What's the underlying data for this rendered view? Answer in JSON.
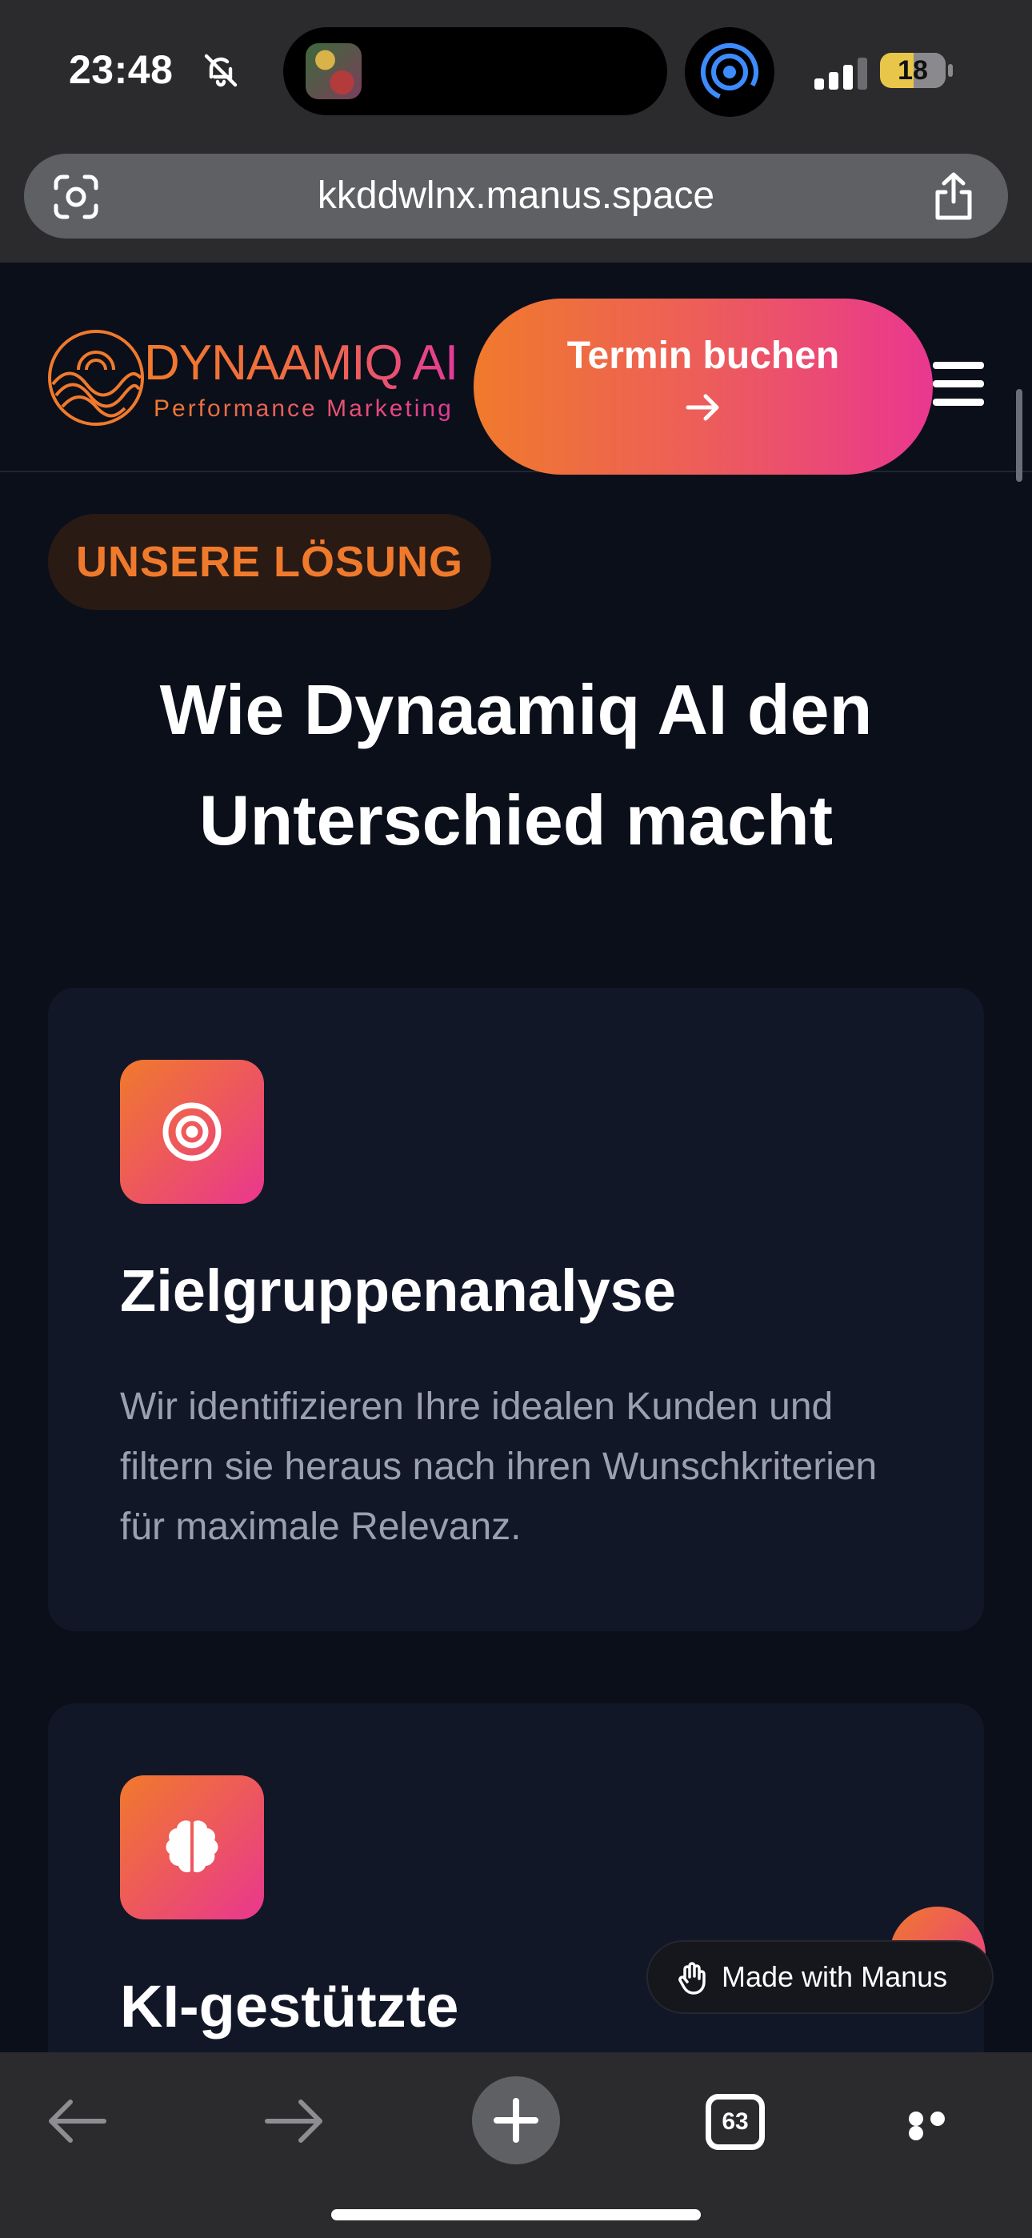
{
  "status_bar": {
    "time": "23:48",
    "battery": "18"
  },
  "browser": {
    "url": "kkddwlnx.manus.space",
    "tab_count": "63"
  },
  "header": {
    "logo_name": "DYNAAMIQ AI",
    "logo_tagline": "Performance Marketing",
    "cta_label": "Termin buchen"
  },
  "main": {
    "badge": "UNSERE LÖSUNG",
    "headline": "Wie Dynaamiq AI den Unterschied macht",
    "cards": [
      {
        "icon": "target-icon",
        "title": "Zielgruppenanalyse",
        "text": "Wir identifizieren Ihre idealen Kunden und filtern sie heraus nach ihren Wunschkriterien für maximale Relevanz."
      },
      {
        "icon": "brain-icon",
        "title": "KI-gestützte",
        "text": ""
      }
    ]
  },
  "manus_badge": {
    "label": "Made with Manus"
  },
  "colors": {
    "accent_orange": "#f07a2c",
    "accent_pink": "#e9378f",
    "background": "#0b0f1a",
    "card": "#121728"
  }
}
